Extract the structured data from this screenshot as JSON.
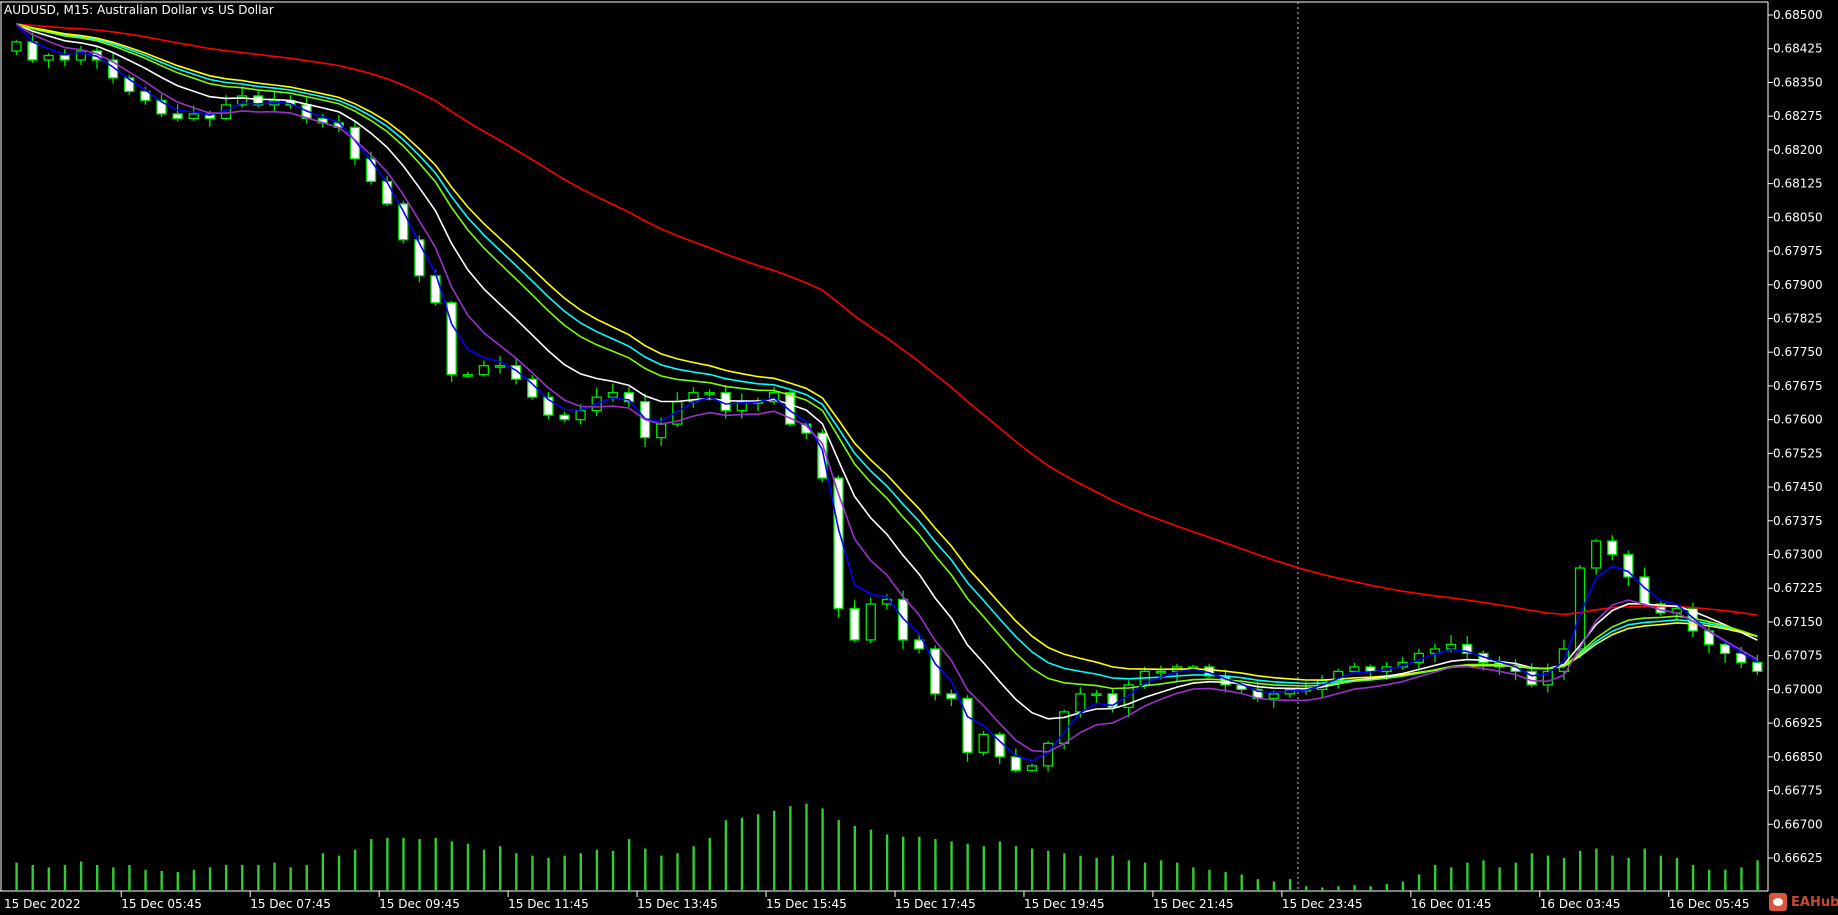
{
  "title": "AUDUSD, M15:  Australian Dollar vs US Dollar",
  "logo_text": "EAHub",
  "colors": {
    "background": "#000000",
    "axis": "#ffffff",
    "candle": "#00e600",
    "bull_body": "#000000",
    "bear_body": "#ffffff",
    "volume": "#32cd32"
  },
  "chart_data": {
    "type": "candlestick",
    "symbol": "AUDUSD",
    "timeframe": "M15",
    "ylim": [
      0.6659,
      0.6851
    ],
    "y_ticks": [
      "0.68500",
      "0.68425",
      "0.68350",
      "0.68275",
      "0.68200",
      "0.68125",
      "0.68050",
      "0.67975",
      "0.67900",
      "0.67825",
      "0.67750",
      "0.67675",
      "0.67600",
      "0.67525",
      "0.67450",
      "0.67375",
      "0.67300",
      "0.67225",
      "0.67150",
      "0.67075",
      "0.67000",
      "0.66925",
      "0.66850",
      "0.66775",
      "0.66700",
      "0.66625"
    ],
    "x_ticks": [
      {
        "bar": 0,
        "label": "15 Dec 2022"
      },
      {
        "bar": 7,
        "label": "15 Dec 05:45"
      },
      {
        "bar": 15,
        "label": "15 Dec 07:45"
      },
      {
        "bar": 23,
        "label": "15 Dec 09:45"
      },
      {
        "bar": 31,
        "label": "15 Dec 11:45"
      },
      {
        "bar": 39,
        "label": "15 Dec 13:45"
      },
      {
        "bar": 47,
        "label": "15 Dec 15:45"
      },
      {
        "bar": 55,
        "label": "15 Dec 17:45"
      },
      {
        "bar": 63,
        "label": "15 Dec 19:45"
      },
      {
        "bar": 71,
        "label": "15 Dec 21:45"
      },
      {
        "bar": 79,
        "label": "15 Dec 23:45"
      },
      {
        "bar": 87,
        "label": "16 Dec 01:45"
      },
      {
        "bar": 95,
        "label": "16 Dec 03:45"
      },
      {
        "bar": 103,
        "label": "16 Dec 05:45"
      }
    ],
    "day_separator_bar": 79.5,
    "first_open": 0.6842,
    "close": [
      0.6844,
      0.684,
      0.6841,
      0.684,
      0.6842,
      0.684,
      0.6836,
      0.6833,
      0.6831,
      0.6828,
      0.6827,
      0.6828,
      0.6827,
      0.683,
      0.6832,
      0.683,
      0.6831,
      0.683,
      0.6827,
      0.6826,
      0.6825,
      0.6818,
      0.6813,
      0.6808,
      0.68,
      0.6792,
      0.6786,
      0.677,
      0.677,
      0.6772,
      0.6772,
      0.6769,
      0.6765,
      0.6761,
      0.676,
      0.6762,
      0.6765,
      0.6766,
      0.6764,
      0.6756,
      0.6759,
      0.6764,
      0.6766,
      0.6766,
      0.6762,
      0.6764,
      0.6764,
      0.6766,
      0.6759,
      0.6757,
      0.6747,
      0.6718,
      0.6711,
      0.6719,
      0.672,
      0.6711,
      0.6709,
      0.6699,
      0.6698,
      0.6686,
      0.669,
      0.6685,
      0.6682,
      0.6683,
      0.6688,
      0.6695,
      0.6699,
      0.6699,
      0.6696,
      0.6701,
      0.6704,
      0.6704,
      0.6705,
      0.6705,
      0.6703,
      0.6701,
      0.67,
      0.6698,
      0.6699,
      0.67,
      0.67,
      0.6702,
      0.6704,
      0.6705,
      0.6704,
      0.6705,
      0.6706,
      0.6708,
      0.6709,
      0.671,
      0.6708,
      0.6706,
      0.6705,
      0.6704,
      0.6701,
      0.6704,
      0.6709,
      0.6727,
      0.6733,
      0.673,
      0.6725,
      0.6719,
      0.6717,
      0.6718,
      0.6713,
      0.671,
      0.6708,
      0.6706,
      0.6704
    ],
    "volume": [
      24,
      22,
      20,
      22,
      25,
      22,
      20,
      22,
      18,
      17,
      16,
      18,
      20,
      22,
      22,
      22,
      24,
      20,
      22,
      32,
      30,
      35,
      44,
      45,
      45,
      44,
      45,
      42,
      40,
      35,
      38,
      32,
      30,
      28,
      30,
      32,
      35,
      34,
      44,
      36,
      30,
      32,
      38,
      45,
      60,
      62,
      65,
      68,
      72,
      74,
      70,
      60,
      55,
      52,
      48,
      46,
      46,
      44,
      42,
      40,
      38,
      42,
      38,
      36,
      34,
      32,
      30,
      28,
      30,
      26,
      24,
      26,
      24,
      20,
      18,
      16,
      14,
      10,
      8,
      10,
      4,
      3,
      4,
      5,
      4,
      6,
      8,
      14,
      22,
      20,
      24,
      26,
      20,
      24,
      32,
      30,
      28,
      34,
      36,
      30,
      28,
      36,
      30,
      28,
      22,
      18,
      18,
      20,
      26
    ],
    "moving_averages": [
      {
        "name": "ma-red",
        "color": "#ff0000"
      },
      {
        "name": "ma-cyan",
        "color": "#00ffff"
      },
      {
        "name": "ma-yellow",
        "color": "#ffff00"
      },
      {
        "name": "ma-white",
        "color": "#ffffff"
      },
      {
        "name": "ma-lawngreen",
        "color": "#7cfc00"
      },
      {
        "name": "ma-blue",
        "color": "#0000ff"
      },
      {
        "name": "ma-purple",
        "color": "#9932cc"
      }
    ]
  }
}
